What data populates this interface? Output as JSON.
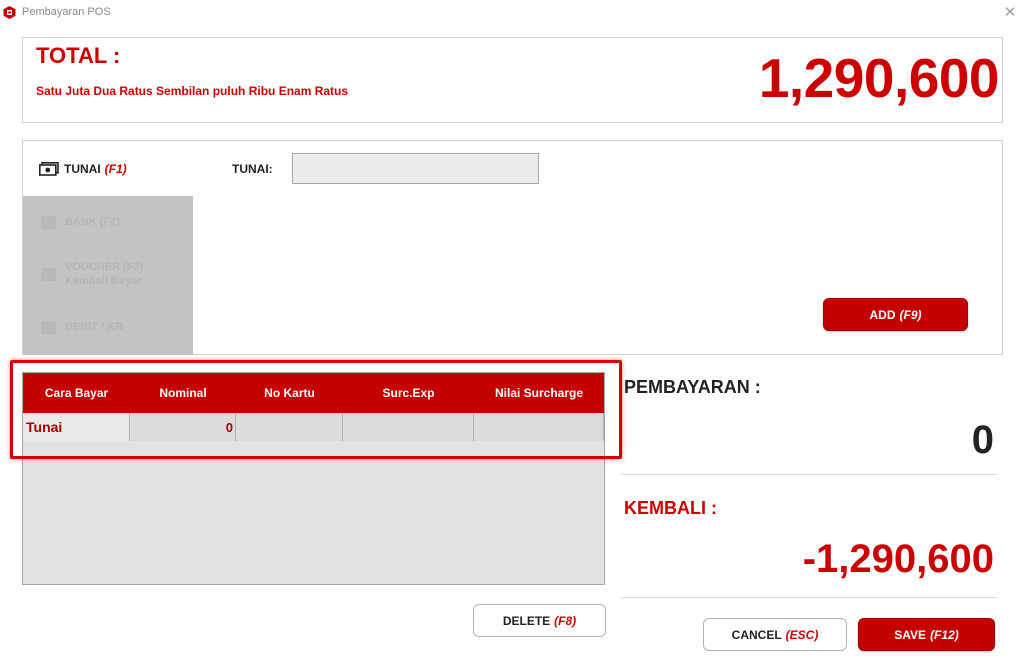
{
  "window": {
    "title": "Pembayaran POS",
    "close": "✕"
  },
  "total": {
    "label": "TOTAL :",
    "amount": "1,290,600",
    "in_words": "Satu Juta Dua Ratus Sembilan puluh Ribu Enam Ratus"
  },
  "methods": {
    "active": {
      "label": "TUNAI",
      "key": "(F1)"
    },
    "items": [
      {
        "label": "BANK (F2)"
      },
      {
        "label": "VOUCHER (F3)",
        "sublabel": "Kembali Bayar"
      },
      {
        "label": "DEBIT / KR"
      }
    ]
  },
  "tunai_field": {
    "label": "TUNAI:",
    "value": "",
    "placeholder": ""
  },
  "add_button": {
    "label": "ADD",
    "key": "(F9)"
  },
  "table": {
    "columns": [
      "Cara Bayar",
      "Nominal",
      "No Kartu",
      "Surc.Exp",
      "Nilai Surcharge"
    ],
    "rows": [
      {
        "cara_bayar": "Tunai",
        "nominal": "0",
        "no_kartu": "",
        "surc_exp": "",
        "nilai_surcharge": ""
      }
    ]
  },
  "pembayaran": {
    "label": "PEMBAYARAN :",
    "amount": "0"
  },
  "kembali": {
    "label": "KEMBALI :",
    "amount": "-1,290,600"
  },
  "buttons": {
    "delete": {
      "label": "DELETE",
      "key": "(F8)"
    },
    "cancel": {
      "label": "CANCEL",
      "key": "(ESC)"
    },
    "save": {
      "label": "SAVE",
      "key": "(F12)"
    }
  },
  "colors": {
    "accent": "#c40000",
    "text": "#222222",
    "panel_gray": "#c3c3c3"
  },
  "icons": {
    "app": "pos-logo-icon",
    "cash": "cash-icon"
  }
}
